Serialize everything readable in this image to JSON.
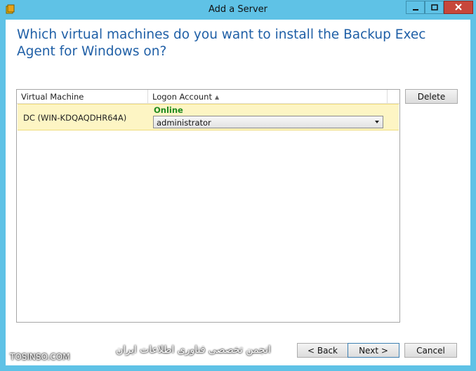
{
  "window": {
    "title": "Add a Server",
    "icon": "backup-exec-app-icon",
    "controls": [
      "minimize-icon",
      "maximize-icon",
      "close-icon"
    ],
    "accent": "#5fc2e6",
    "close_color": "#c7473b"
  },
  "heading": "Which virtual machines do you want to install the Backup Exec Agent for Windows on?",
  "grid": {
    "columns": [
      "Virtual Machine",
      "Logon Account"
    ],
    "sort_icon": "sort-ascending-icon",
    "rows": [
      {
        "vm": "DC (WIN-KDQAQDHR64A)",
        "status": "Online",
        "status_color": "#1f8a1f",
        "account": "administrator"
      }
    ]
  },
  "buttons": {
    "delete": "Delete",
    "back": "< Back",
    "next": "Next >",
    "cancel": "Cancel"
  },
  "watermark": {
    "left": "TOSINSO.COM",
    "right": "انجمن تخصصی فناوری اطلاعات ایران"
  }
}
